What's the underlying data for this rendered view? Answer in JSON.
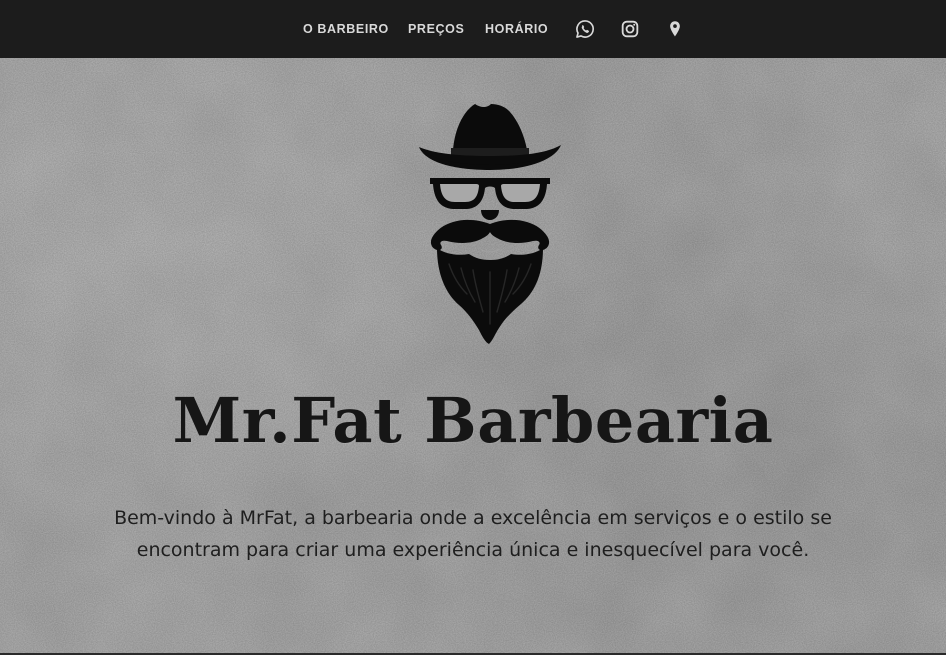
{
  "nav": {
    "items": [
      {
        "label": "O BARBEIRO"
      },
      {
        "label": "PREÇOS"
      },
      {
        "label": "HORÁRIO"
      }
    ],
    "icons": [
      "whatsapp-icon",
      "instagram-icon",
      "location-pin-icon"
    ]
  },
  "hero": {
    "title": "Mr.Fat Barbearia",
    "welcome_text": "Bem-vindo à MrFat, a barbearia onde a excelência em serviços e o estilo se encontram para criar uma experiência única e inesquecível para você.",
    "logo_icon": "hipster-man-hat-glasses-beard-logo"
  },
  "colors": {
    "navbar_background": "#1c1c1c",
    "nav_text": "#d9d9d9",
    "hero_background": "#a8a8a8",
    "title_text": "#161616",
    "body_text": "#1e1e1e"
  }
}
